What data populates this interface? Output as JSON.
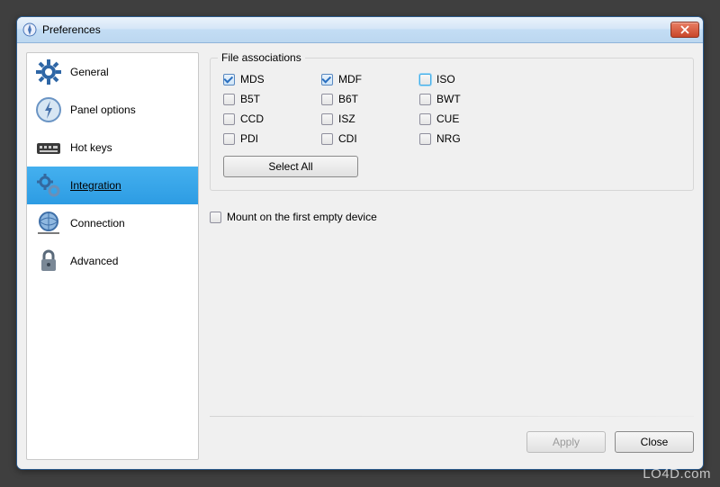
{
  "window": {
    "title": "Preferences"
  },
  "sidebar": {
    "items": [
      {
        "label": "General",
        "icon": "gear-icon",
        "selected": false
      },
      {
        "label": "Panel options",
        "icon": "bolt-icon",
        "selected": false
      },
      {
        "label": "Hot keys",
        "icon": "keyboard-icon",
        "selected": false
      },
      {
        "label": "Integration",
        "icon": "gear-link-icon",
        "selected": true
      },
      {
        "label": "Connection",
        "icon": "globe-icon",
        "selected": false
      },
      {
        "label": "Advanced",
        "icon": "lock-icon",
        "selected": false
      }
    ]
  },
  "content": {
    "group_title": "File associations",
    "checks": [
      {
        "label": "MDS",
        "checked": true,
        "highlight": false
      },
      {
        "label": "MDF",
        "checked": true,
        "highlight": false
      },
      {
        "label": "ISO",
        "checked": false,
        "highlight": true
      },
      {
        "label": "B5T",
        "checked": false,
        "highlight": false
      },
      {
        "label": "B6T",
        "checked": false,
        "highlight": false
      },
      {
        "label": "BWT",
        "checked": false,
        "highlight": false
      },
      {
        "label": "CCD",
        "checked": false,
        "highlight": false
      },
      {
        "label": "ISZ",
        "checked": false,
        "highlight": false
      },
      {
        "label": "CUE",
        "checked": false,
        "highlight": false
      },
      {
        "label": "PDI",
        "checked": false,
        "highlight": false
      },
      {
        "label": "CDI",
        "checked": false,
        "highlight": false
      },
      {
        "label": "NRG",
        "checked": false,
        "highlight": false
      }
    ],
    "select_all_label": "Select All",
    "mount_label": "Mount on the first empty device",
    "mount_checked": false
  },
  "footer": {
    "apply_label": "Apply",
    "close_label": "Close"
  },
  "watermark": "LO4D.com"
}
